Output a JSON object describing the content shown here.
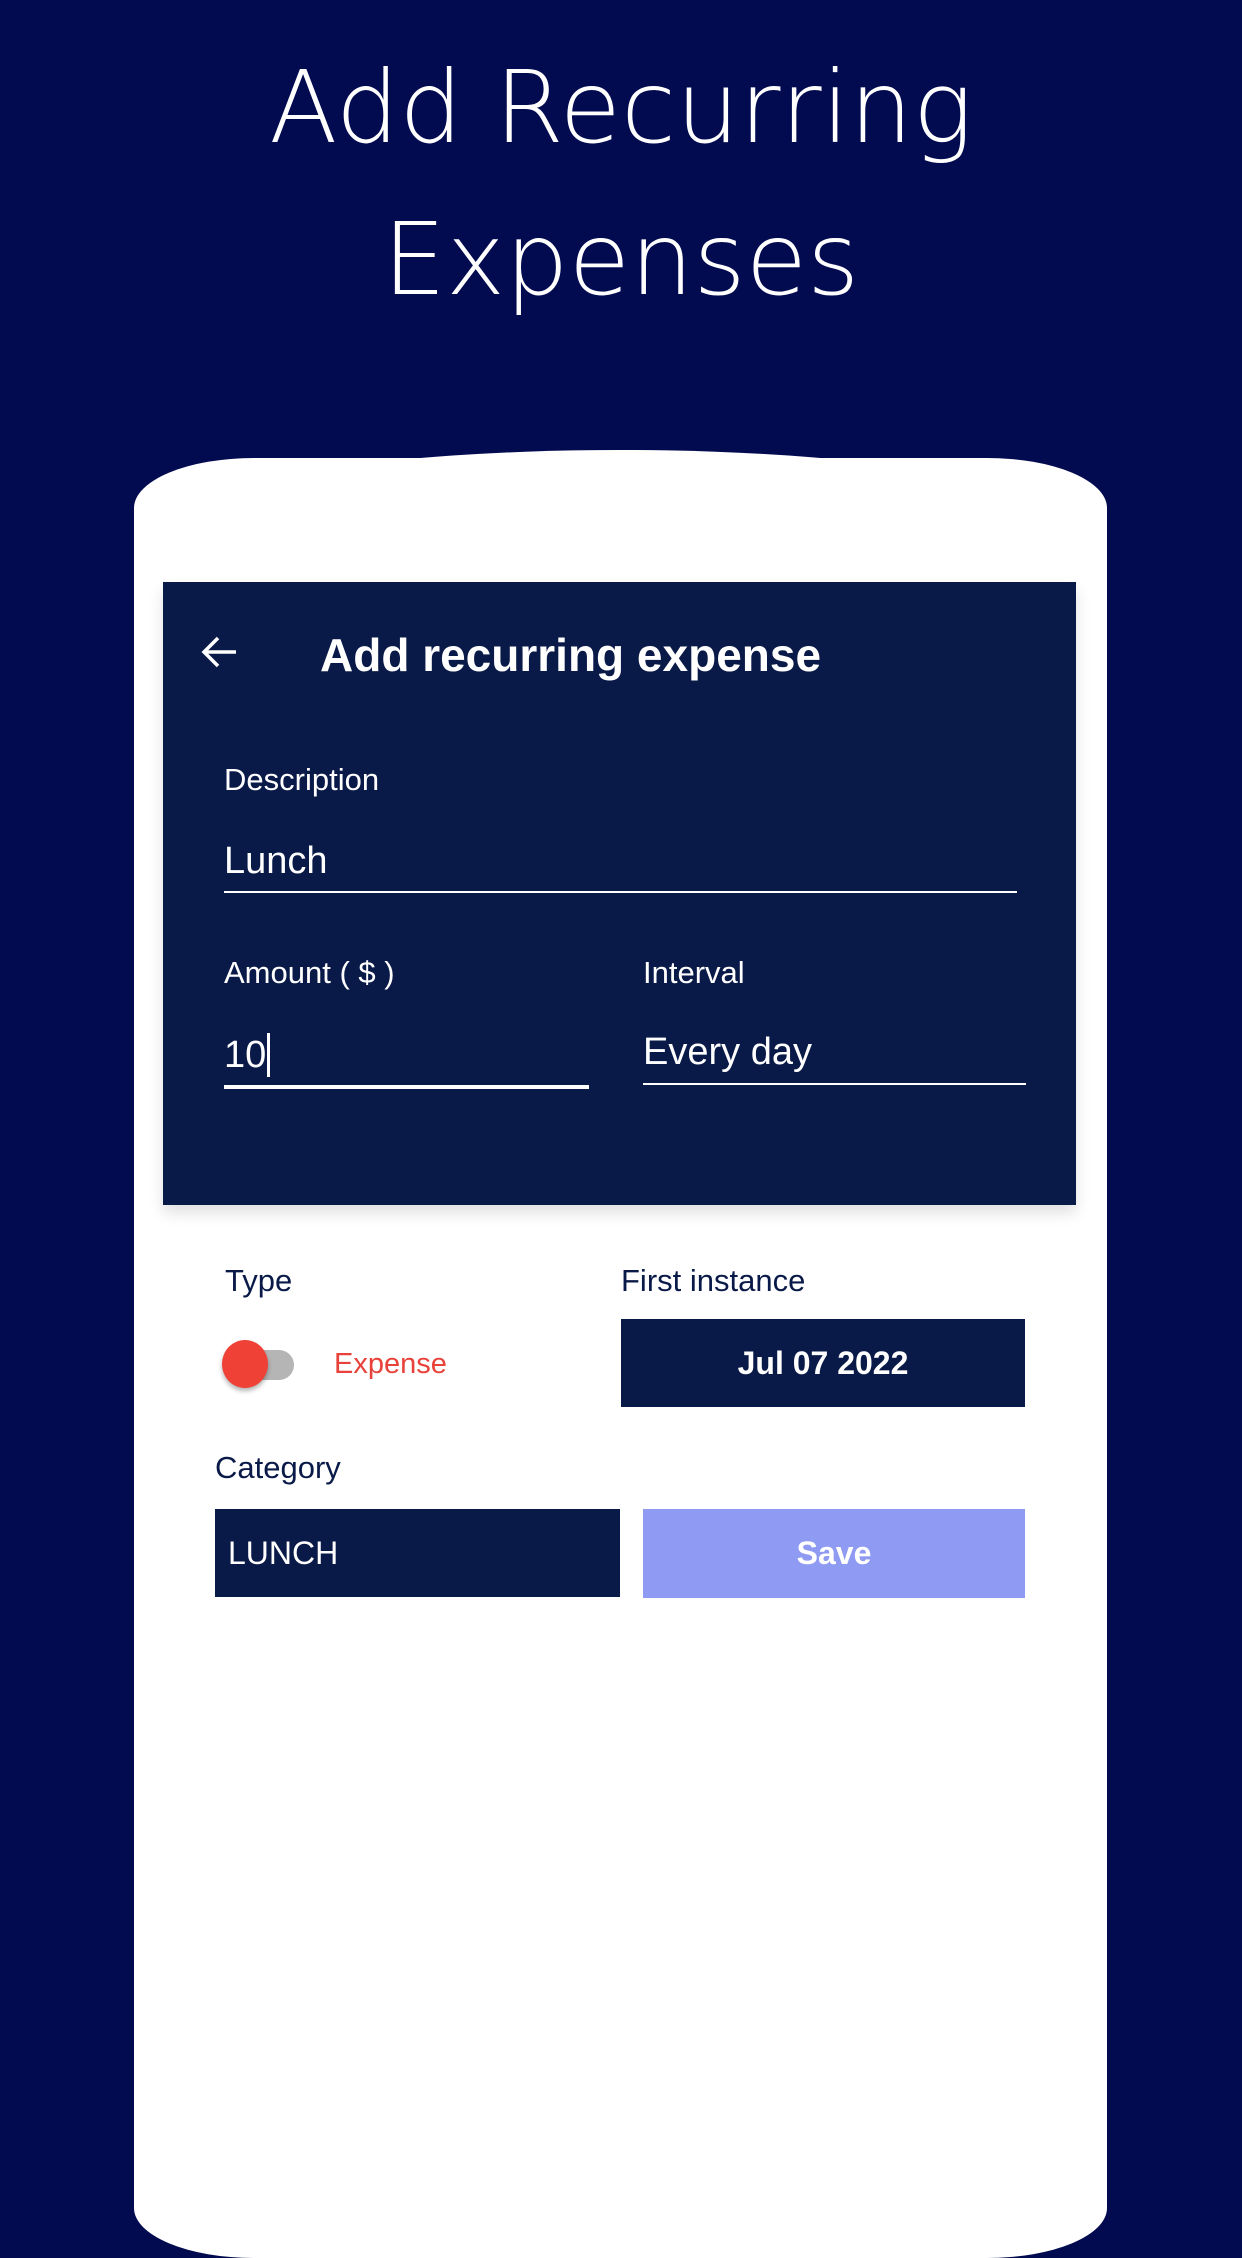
{
  "hero": {
    "line1": "Add Recurring",
    "line2": "Expenses"
  },
  "appbar": {
    "title": "Add recurring expense",
    "back_icon": "arrow-left-icon"
  },
  "form": {
    "description": {
      "label": "Description",
      "value": "Lunch"
    },
    "amount": {
      "label": "Amount ( $ )",
      "value": "10"
    },
    "interval": {
      "label": "Interval",
      "value": "Every day"
    },
    "type": {
      "label": "Type",
      "value": "Expense",
      "toggle_on": false,
      "color": "#e8433a"
    },
    "first_instance": {
      "label": "First instance",
      "value": "Jul 07 2022"
    },
    "category": {
      "label": "Category",
      "value": "LUNCH"
    },
    "save_label": "Save"
  },
  "colors": {
    "background": "#020a50",
    "panel": "#0a1a48",
    "save": "#8f9af2"
  }
}
